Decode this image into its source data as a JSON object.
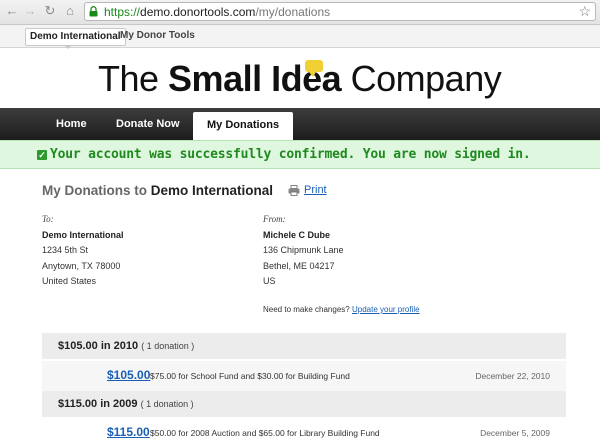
{
  "browser": {
    "url_scheme": "https://",
    "url_host": "demo.donortools.com",
    "url_path": "/my/donations"
  },
  "tabs": {
    "active": "Demo International",
    "other": "My Donor Tools"
  },
  "logo": {
    "part1": "The ",
    "part2": "Small Idea",
    "part3": " Company"
  },
  "nav": {
    "items": [
      "Home",
      "Donate Now",
      "My Donations"
    ],
    "active_index": 2
  },
  "flash": {
    "message": "Your account was successfully confirmed. You are now signed in.",
    "color": "#1f8a1f"
  },
  "heading": {
    "prefix": "My Donations to ",
    "org": "Demo International",
    "print_label": "Print"
  },
  "to": {
    "label": "To:",
    "name": "Demo International",
    "line1": "1234 5th St",
    "line2": "Anytown, TX 78000",
    "line3": "United States"
  },
  "from": {
    "label": "From:",
    "name": "Michele C Dube",
    "line1": "136 Chipmunk Lane",
    "line2": "Bethel, ME 04217",
    "line3": "US"
  },
  "change": {
    "prompt": "Need to make changes?",
    "link": "Update your profile"
  },
  "years": [
    {
      "title": "$105.00 in 2010",
      "count": "( 1 donation )",
      "donation": {
        "amount": "$105.00",
        "description": "$75.00 for School Fund and $30.00 for Building Fund",
        "date": "December 22, 2010"
      }
    },
    {
      "title": "$115.00 in 2009",
      "count": "( 1 donation )",
      "donation": {
        "amount": "$115.00",
        "description": "$50.00 for 2008 Auction and $65.00 for Library Building Fund",
        "date": "December 5, 2009"
      }
    }
  ]
}
